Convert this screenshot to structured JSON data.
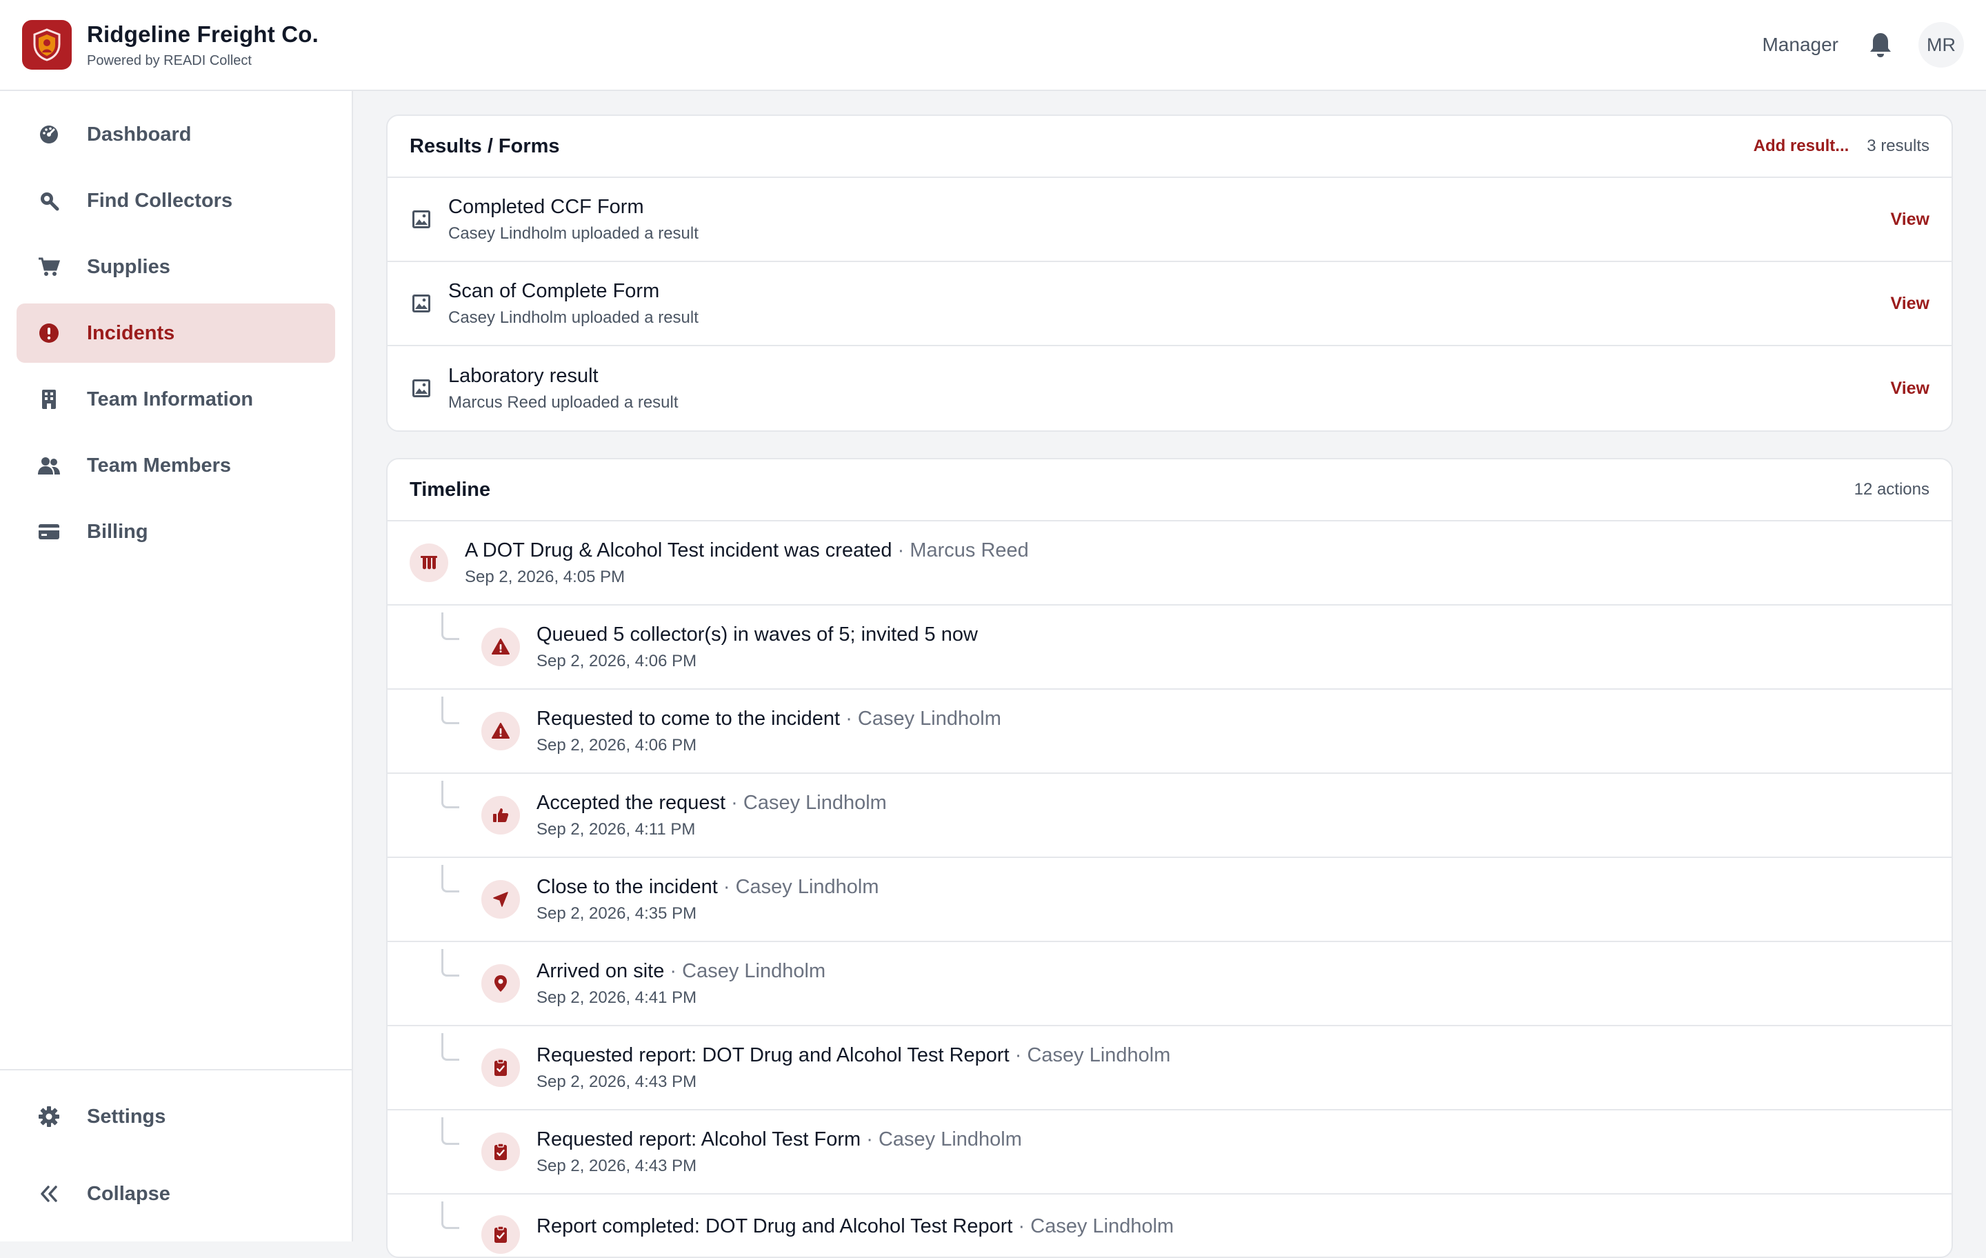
{
  "header": {
    "brand_name": "Ridgeline Freight Co.",
    "brand_sub": "Powered by READI Collect",
    "role": "Manager",
    "avatar_initials": "MR"
  },
  "sidebar": {
    "items": [
      {
        "label": "Dashboard",
        "icon": "dashboard-icon"
      },
      {
        "label": "Find Collectors",
        "icon": "search-icon"
      },
      {
        "label": "Supplies",
        "icon": "cart-icon"
      },
      {
        "label": "Incidents",
        "icon": "alert-circle-icon",
        "active": true
      },
      {
        "label": "Team Information",
        "icon": "building-icon"
      },
      {
        "label": "Team Members",
        "icon": "users-icon"
      },
      {
        "label": "Billing",
        "icon": "credit-card-icon"
      }
    ],
    "bottom": [
      {
        "label": "Settings",
        "icon": "gear-icon"
      },
      {
        "label": "Collapse",
        "icon": "chevrons-left-icon"
      }
    ]
  },
  "results": {
    "title": "Results / Forms",
    "add_label": "Add result...",
    "count": "3 results",
    "view_label": "View",
    "rows": [
      {
        "title": "Completed CCF Form",
        "sub": "Casey Lindholm uploaded a result"
      },
      {
        "title": "Scan of Complete Form",
        "sub": "Casey Lindholm uploaded a result"
      },
      {
        "title": "Laboratory result",
        "sub": "Marcus Reed uploaded a result"
      }
    ]
  },
  "timeline": {
    "title": "Timeline",
    "count": "12 actions",
    "separator": "·",
    "entries": [
      {
        "text": "A DOT Drug & Alcohol Test incident was created",
        "actor": "Marcus Reed",
        "date": "Sep 2, 2026, 4:05 PM",
        "icon": "flask-icon"
      },
      {
        "text": "Queued 5 collector(s) in waves of 5; invited 5 now",
        "actor": "",
        "date": "Sep 2, 2026, 4:06 PM",
        "icon": "warning-icon"
      },
      {
        "text": "Requested to come to the incident",
        "actor": "Casey Lindholm",
        "date": "Sep 2, 2026, 4:06 PM",
        "icon": "warning-icon"
      },
      {
        "text": "Accepted the request",
        "actor": "Casey Lindholm",
        "date": "Sep 2, 2026, 4:11 PM",
        "icon": "thumbs-up-icon"
      },
      {
        "text": "Close to the incident",
        "actor": "Casey Lindholm",
        "date": "Sep 2, 2026, 4:35 PM",
        "icon": "navigation-arrow-icon"
      },
      {
        "text": "Arrived on site",
        "actor": "Casey Lindholm",
        "date": "Sep 2, 2026, 4:41 PM",
        "icon": "map-pin-icon"
      },
      {
        "text": "Requested report: DOT Drug and Alcohol Test Report",
        "actor": "Casey Lindholm",
        "date": "Sep 2, 2026, 4:43 PM",
        "icon": "clipboard-check-icon"
      },
      {
        "text": "Requested report: Alcohol Test Form",
        "actor": "Casey Lindholm",
        "date": "Sep 2, 2026, 4:43 PM",
        "icon": "clipboard-check-icon"
      },
      {
        "text": "Report completed: DOT Drug and Alcohol Test Report",
        "actor": "Casey Lindholm",
        "date": "",
        "icon": "clipboard-check-icon"
      }
    ]
  },
  "colors": {
    "brand": "#b01f24",
    "accent_text": "#9b1c1c",
    "active_bg": "#f2dede",
    "icon_bg": "#f6e4e4"
  }
}
